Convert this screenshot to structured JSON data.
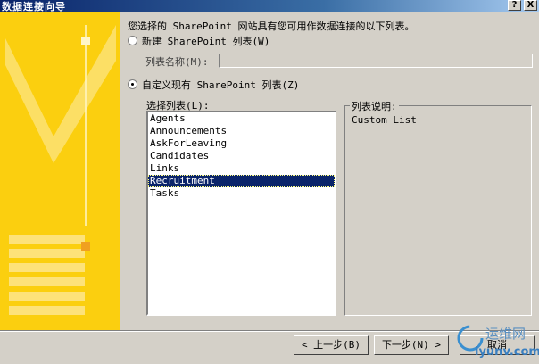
{
  "window": {
    "title": "数据连接向导",
    "help_btn": "?",
    "close_btn": "X"
  },
  "intro": "您选择的 SharePoint 网站具有您可用作数据连接的以下列表。",
  "option_new": {
    "label": "新建 SharePoint 列表(W)",
    "selected": false
  },
  "list_name": {
    "label": "列表名称(M):",
    "value": ""
  },
  "option_existing": {
    "label": "自定义现有 SharePoint 列表(Z)",
    "selected": true
  },
  "lists": {
    "label": "选择列表(L):",
    "items": [
      "Agents",
      "Announcements",
      "AskForLeaving",
      "Candidates",
      "Links",
      "Recruitment",
      "Tasks"
    ],
    "selected": "Recruitment"
  },
  "description": {
    "label": "列表说明:",
    "text": "Custom List"
  },
  "buttons": {
    "back": "< 上一步(B)",
    "next": "下一步(N) >",
    "cancel": "取消"
  },
  "watermark": {
    "name": "运维网",
    "url": "iyunv.com"
  }
}
